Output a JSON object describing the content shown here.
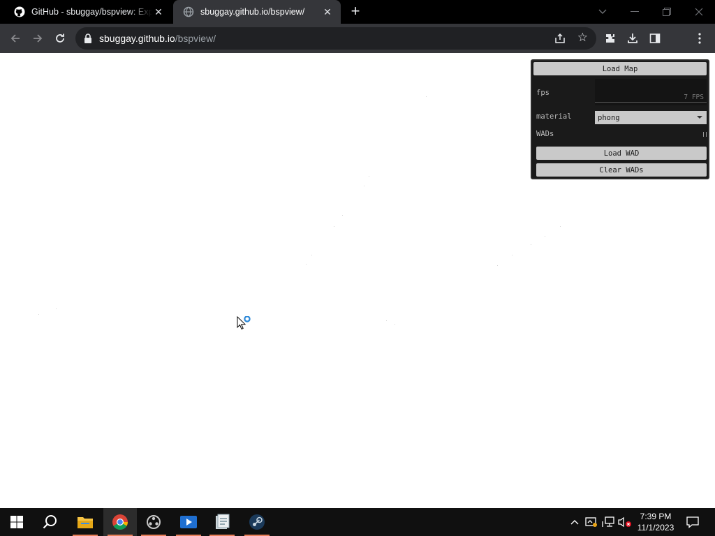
{
  "browser": {
    "tabs": [
      {
        "title": "GitHub - sbuggay/bspview: Expl",
        "icon": "github-icon"
      },
      {
        "title": "sbuggay.github.io/bspview/",
        "icon": "globe-icon"
      }
    ],
    "url_host": "sbuggay.github.io",
    "url_path": "/bspview/"
  },
  "gui": {
    "load_map": "Load Map",
    "fps_label": "fps",
    "fps_value": "7 FPS",
    "material_label": "material",
    "material_value": "phong",
    "wads_label": "WADs",
    "load_wad": "Load WAD",
    "clear_wads": "Clear WADs"
  },
  "taskbar": {
    "apps": [
      "file-explorer-icon",
      "chrome-icon",
      "resolve-icon",
      "media-player-icon",
      "notepad-icon",
      "steam-icon"
    ],
    "time": "7:39 PM",
    "date": "11/1/2023"
  },
  "colors": {
    "tab_bg": "#000000",
    "toolbar_bg": "#35363a",
    "omnibox_bg": "#202124",
    "gui_bg": "#1a1a1a",
    "gui_button": "#c9c9c9",
    "taskbar_bg": "#101010",
    "running_indicator": "#e8805a"
  }
}
